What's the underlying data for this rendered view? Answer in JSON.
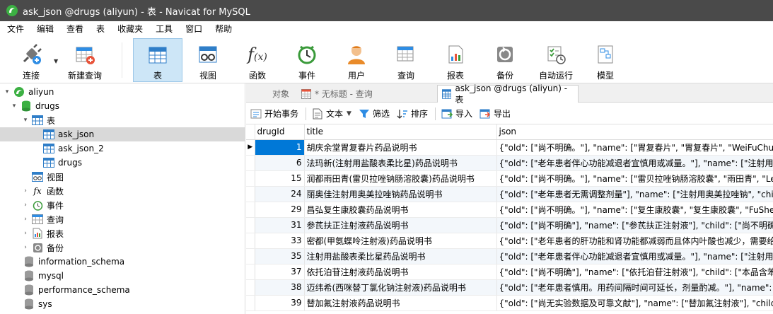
{
  "window": {
    "title": "ask_json @drugs (aliyun) - 表 - Navicat for MySQL"
  },
  "menu": [
    "文件",
    "编辑",
    "查看",
    "表",
    "收藏夹",
    "工具",
    "窗口",
    "帮助"
  ],
  "toolbar": {
    "connect": "连接",
    "new_query": "新建查询",
    "table": "表",
    "view": "视图",
    "function": "函数",
    "event": "事件",
    "user": "用户",
    "query": "查询",
    "report": "报表",
    "backup": "备份",
    "automation": "自动运行",
    "model": "模型"
  },
  "nav": {
    "connection": "aliyun",
    "database": "drugs",
    "tables_label": "表",
    "tables": [
      "ask_json",
      "ask_json_2",
      "drugs"
    ],
    "views": "视图",
    "functions": "函数",
    "events": "事件",
    "queries": "查询",
    "reports": "报表",
    "backups": "备份",
    "other_dbs": [
      "information_schema",
      "mysql",
      "performance_schema",
      "sys"
    ]
  },
  "tabs": {
    "objects": "对象",
    "untitled_query": "* 无标题 - 查询",
    "active": "ask_json @drugs (aliyun) - 表"
  },
  "subtoolbar": {
    "begin_transaction": "开始事务",
    "text": "文本",
    "filter": "筛选",
    "sort": "排序",
    "import": "导入",
    "export": "导出"
  },
  "grid": {
    "columns": [
      "drugId",
      "title",
      "json"
    ],
    "rows": [
      {
        "id": "1",
        "title": "胡庆余堂胃复春片药品说明书",
        "json": "{\"old\": [\"尚不明确。\"], \"name\": [\"胃复春片\", \"胃复春片\", \"WeiFuChunPi"
      },
      {
        "id": "6",
        "title": "法玛新(注射用盐酸表柔比星)药品说明书",
        "json": "{\"old\": [\"老年患者伴心功能减退者宜慎用或减量。\"], \"name\": [\"注射用盐"
      },
      {
        "id": "15",
        "title": "润都雨田青(雷贝拉唑钠肠溶胶囊)药品说明书",
        "json": "{\"old\": [\"尚不明确。\"], \"name\": [\"雷贝拉唑钠肠溶胶囊\", \"雨田青\", \"LeiBe"
      },
      {
        "id": "24",
        "title": "丽奥佳注射用奥美拉唑钠药品说明书",
        "json": "{\"old\": [\"老年患者无需调整剂量\"], \"name\": [\"注射用奥美拉唑钠\", \"child"
      },
      {
        "id": "29",
        "title": "昌弘复生康胶囊药品说明书",
        "json": "{\"old\": [\"尚不明确。\"], \"name\": [\"复生康胶囊\", \"复生康胶囊\", \"FuSheng"
      },
      {
        "id": "31",
        "title": "参芪扶正注射液药品说明书",
        "json": "{\"old\": [\"尚不明确\"], \"name\": [\"参芪扶正注射液\"], \"child\": [\"尚不明确\"],"
      },
      {
        "id": "33",
        "title": "密都(甲氨蝶呤注射液)药品说明书",
        "json": "{\"old\": [\"老年患者的肝功能和肾功能都减弱而且体内叶酸也减少，需要给"
      },
      {
        "id": "35",
        "title": "注射用盐酸表柔比星药品说明书",
        "json": "{\"old\": [\"老年患者伴心功能减退者宜慎用或减量。\"], \"name\": [\"注射用盐"
      },
      {
        "id": "37",
        "title": "依托泊苷注射液药品说明书",
        "json": "{\"old\": [\"尚不明确\"], \"name\": [\"依托泊苷注射液\"], \"child\": [\"本品含苯甲醇"
      },
      {
        "id": "38",
        "title": "迈纬希(西咪替丁氯化钠注射液)药品说明书",
        "json": "{\"old\": [\"老年患者慎用。用药间隔时间可延长，剂量酌减。\"], \"name\": ["
      },
      {
        "id": "39",
        "title": "替加氟注射液药品说明书",
        "json": "{\"old\": [\"尚无实验数据及可靠文献\"], \"name\": [\"替加氟注射液\"], \"child\": ["
      }
    ]
  }
}
